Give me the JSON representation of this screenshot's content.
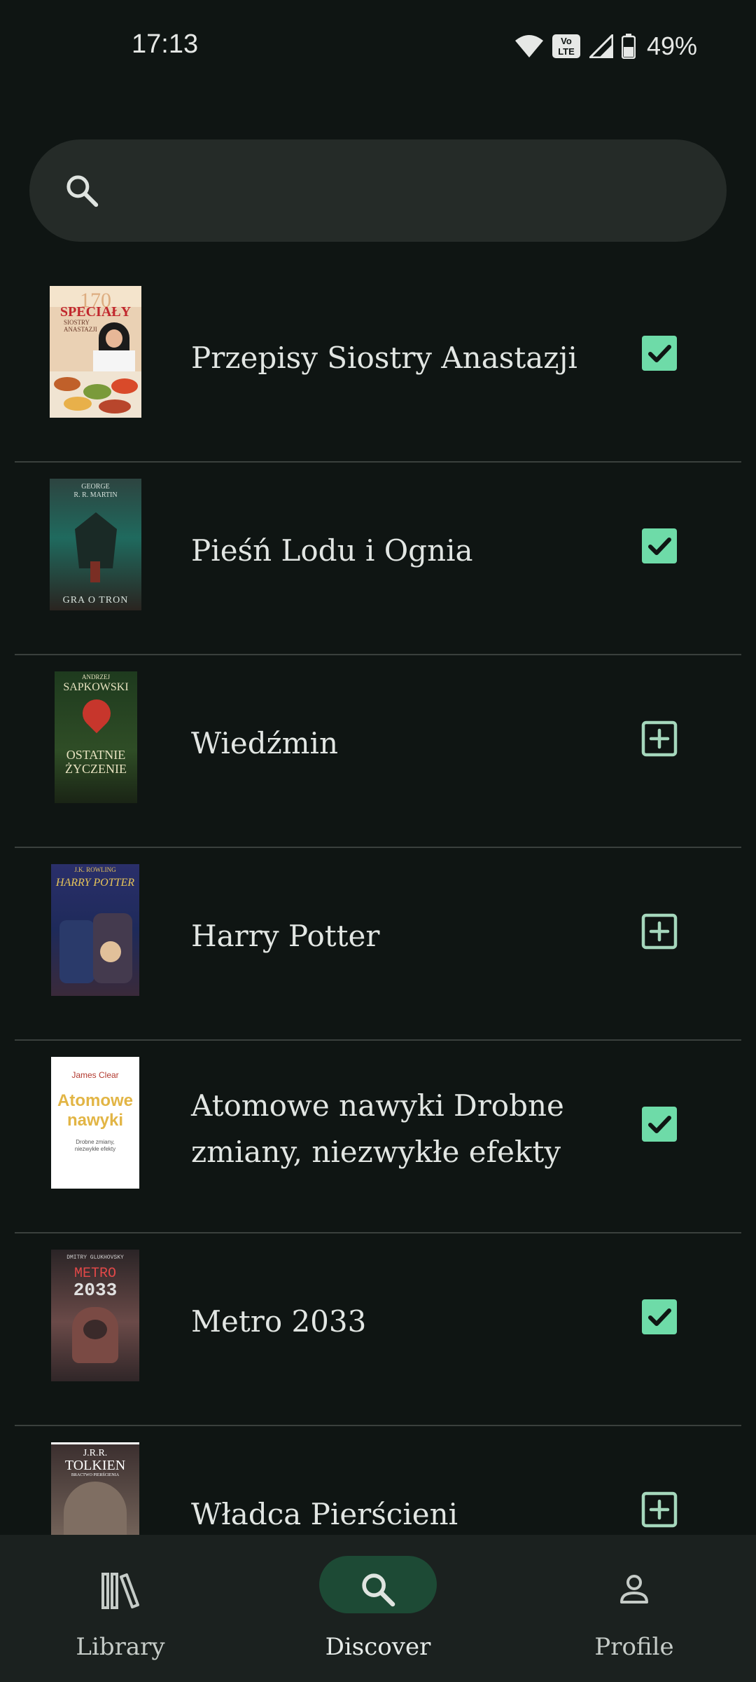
{
  "status_bar": {
    "time": "17:13",
    "icons": [
      "wifi-icon",
      "volte-icon",
      "signal-icon",
      "battery-icon"
    ],
    "volte_line1": "Vo",
    "volte_line2": "LTE",
    "battery": "49%"
  },
  "search": {
    "placeholder": "",
    "icon": "search-icon"
  },
  "books": [
    {
      "title": "Przepisy Siostry Anastazji",
      "in_library": true,
      "cover": {
        "bg": "#e9c5a3",
        "accent": "#c1272d",
        "lines": [
          "170",
          "SPECIAŁY",
          "SIOSTRY",
          "ANASTAZJI"
        ]
      }
    },
    {
      "title": "Pieśń Lodu i Ognia",
      "in_library": true,
      "cover": {
        "bg": "#243633",
        "accent": "#c9d6cf",
        "lines": [
          "GEORGE",
          "R. R. MARTIN",
          "GRA O TRON"
        ]
      }
    },
    {
      "title": "Wiedźmin",
      "in_library": false,
      "cover": {
        "bg": "#233a22",
        "accent": "#e7e2c0",
        "lines": [
          "ANDRZEJ",
          "SAPKOWSKI",
          "OSTATNIE",
          "ŻYCZENIE"
        ]
      }
    },
    {
      "title": "Harry Potter",
      "in_library": false,
      "cover": {
        "bg": "#27356b",
        "accent": "#e7c45a",
        "lines": [
          "J.K. ROWLING",
          "HARRY POTTER"
        ]
      }
    },
    {
      "title": "Atomowe nawyki Drobne zmiany, niezwykłe efekty",
      "in_library": true,
      "cover": {
        "bg": "#ffffff",
        "accent": "#e2b545",
        "lines": [
          "James Clear",
          "Atomowe",
          "nawyki",
          "Drobne zmiany,",
          "niezwykłe efekty"
        ]
      }
    },
    {
      "title": "Metro 2033",
      "in_library": true,
      "cover": {
        "bg": "#3b2a2c",
        "accent": "#d9d9d9",
        "lines": [
          "DMITRY GLUKHOVSKY",
          "METRO",
          "2033"
        ]
      }
    },
    {
      "title": "Władca Pierścieni",
      "in_library": false,
      "cover": {
        "bg": "#4a3a34",
        "accent": "#ffffff",
        "lines": [
          "J.R.R.",
          "TOLKIEN",
          "BRACTWO PIERŚCIENIA"
        ]
      }
    }
  ],
  "nav": {
    "items": [
      {
        "label": "Library",
        "icon": "library-icon",
        "active": false
      },
      {
        "label": "Discover",
        "icon": "search-icon",
        "active": true
      },
      {
        "label": "Profile",
        "icon": "person-icon",
        "active": false
      }
    ]
  },
  "colors": {
    "background": "#0f1513",
    "accent_check": "#6edba8",
    "add_icon": "#a5d7bc",
    "active_pill": "#1d4a35"
  }
}
